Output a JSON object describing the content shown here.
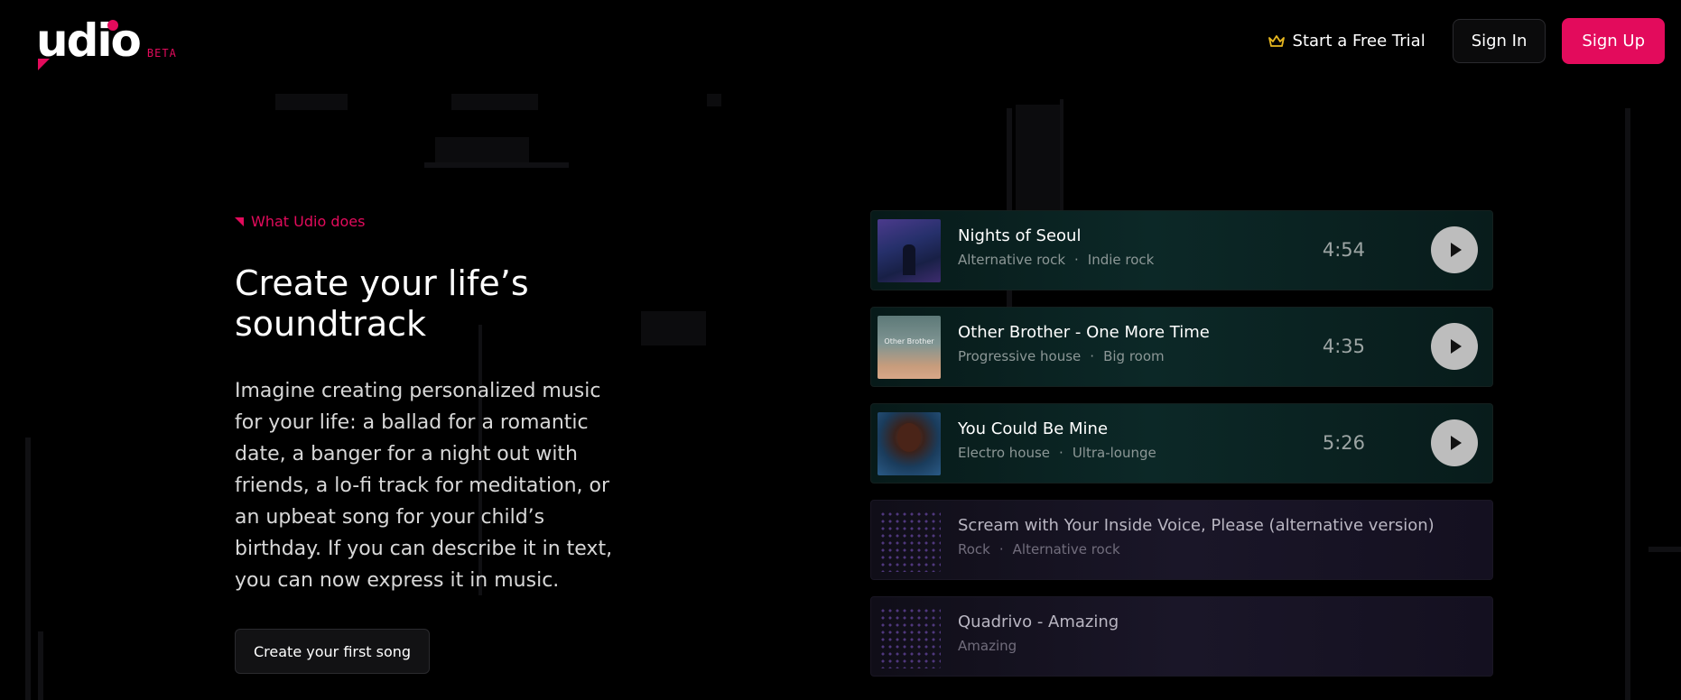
{
  "brand": {
    "name": "udio",
    "badge": "BETA",
    "accent": "#e30b5c"
  },
  "nav": {
    "trial_label": "Start a Free Trial",
    "signin_label": "Sign In",
    "signup_label": "Sign Up"
  },
  "hero": {
    "eyebrow": "What Udio does",
    "title": "Create your life’s soundtrack",
    "body": "Imagine creating personalized music for your life: a ballad for a romantic date, a banger for a night out with friends, a lo-fi track for meditation, or an upbeat song for your child’s birthday. If you can describe it in text, you can now express it in music.",
    "cta_label": "Create your first song"
  },
  "tracks": [
    {
      "title": "Nights of Seoul",
      "genres": [
        "Alternative rock",
        "Indie rock"
      ],
      "duration": "4:54",
      "separator": "·"
    },
    {
      "title": "Other Brother - One More Time",
      "genres": [
        "Progressive house",
        "Big room"
      ],
      "duration": "4:35",
      "art_text": "Other Brother",
      "separator": "·"
    },
    {
      "title": "You Could Be Mine",
      "genres": [
        "Electro house",
        "Ultra-lounge"
      ],
      "duration": "5:26",
      "separator": "·"
    },
    {
      "title": "Scream with Your Inside Voice, Please (alternative version)",
      "genres": [
        "Rock",
        "Alternative rock"
      ],
      "separator": "·"
    },
    {
      "title": "Quadrivo - Amazing",
      "genres": [
        "Amazing"
      ]
    }
  ],
  "icons": {
    "trial": "crown-icon",
    "play": "play-icon"
  }
}
